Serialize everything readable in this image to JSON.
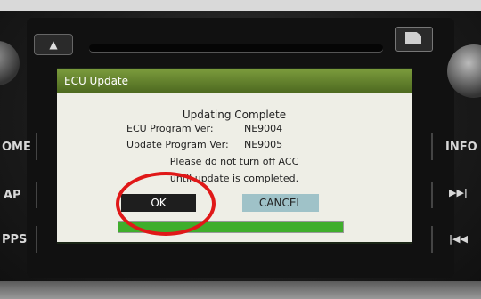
{
  "device": {
    "left_buttons": [
      "OME",
      "AP",
      "PPS"
    ],
    "right_buttons": [
      "INFO"
    ],
    "eject_icon": "eject-icon",
    "sd_icon": "sd-card-icon",
    "skip_forward_icon": "skip-forward-icon",
    "skip_back_icon": "skip-back-icon"
  },
  "dialog": {
    "title": "ECU Update",
    "heading": "Updating Complete",
    "ecu_label": "ECU Program Ver:",
    "ecu_value": "NE9004",
    "update_label": "Update Program Ver:",
    "update_value": "NE9005",
    "message_line1": "Please do not turn off ACC",
    "message_line2": "until update is completed.",
    "ok_label": "OK",
    "cancel_label": "CANCEL",
    "progress_percent": 100
  },
  "colors": {
    "titlebar": "#5e7d2a",
    "progress": "#3fae2c",
    "highlight_circle": "#e01818"
  }
}
